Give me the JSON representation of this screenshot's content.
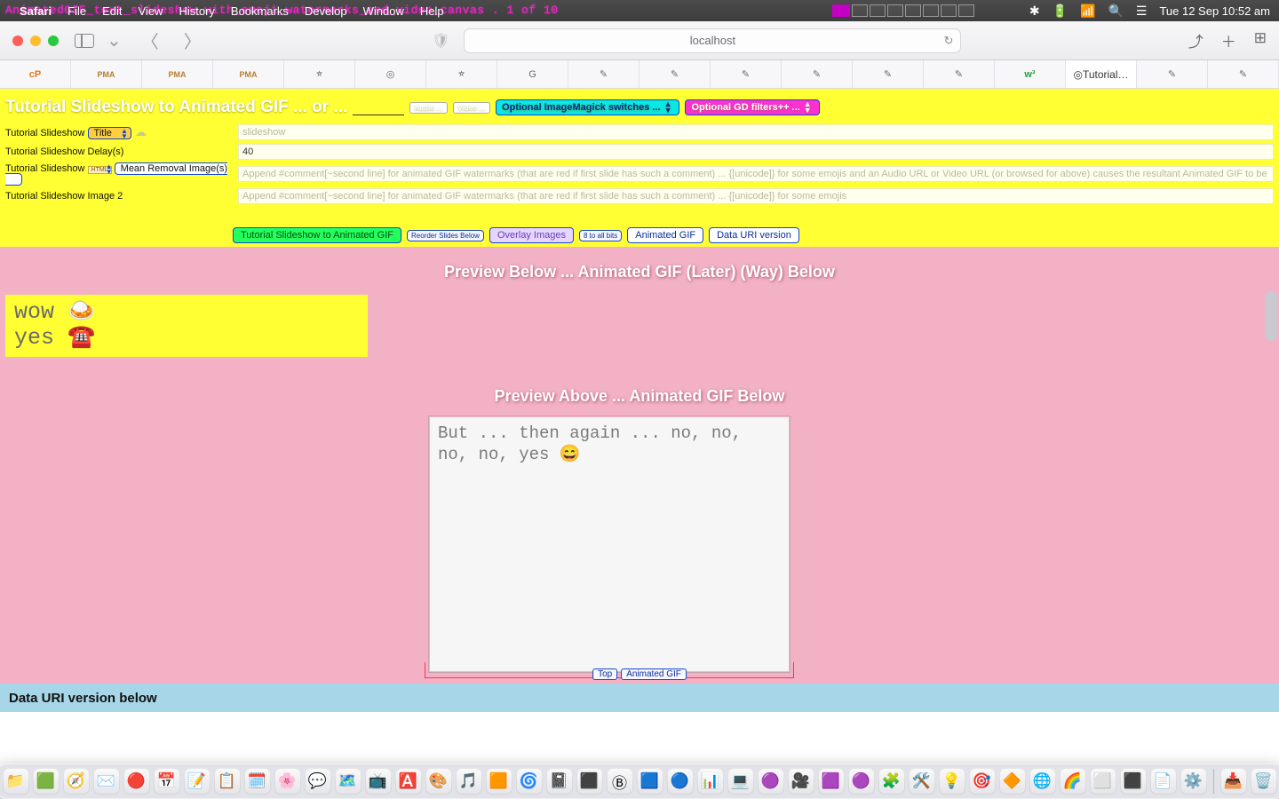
{
  "menubar": {
    "ghost": "AnimatedGIF_text_slideshow_with_emoji_watermarks_and_video_canvas . 1 of 10",
    "app": "Safari",
    "items": [
      "File",
      "Edit",
      "View",
      "History",
      "Bookmarks",
      "Develop",
      "Window",
      "Help"
    ],
    "clock": "Tue 12 Sep  10:52 am"
  },
  "safari": {
    "url": "localhost",
    "tabs": [
      "cP",
      "PMA",
      "PMA",
      "PMA",
      "⭐︎",
      "◎",
      "⭐︎",
      "G",
      "✎",
      "✎",
      "✎",
      "✎",
      "✎",
      "✎",
      "w³",
      "Tutorial…",
      "✎",
      "✎"
    ],
    "activeTab": 15
  },
  "form": {
    "heading": "Tutorial Slideshow to Animated GIF ... or ...",
    "audio_btn": "Audio …",
    "video_btn": "Video …",
    "im_switches": "Optional ImageMagick switches ...",
    "gd_filters": "Optional GD filters++ ...",
    "row1_label": "Tutorial Slideshow",
    "title_sel": "Title",
    "title_val": "slideshow",
    "row2_label": "Tutorial Slideshow Delay(s)",
    "delay_val": "40",
    "row3_label": "Tutorial Slideshow",
    "html_badge": "HTML",
    "mr_sel": "Mean Removal Image(s)",
    "img1_ph": "Append #comment[~second line] for animated GIF watermarks (that are red if first slide has such a comment) ... {[unicode]} for some emojis and an Audio URL or Video URL (or browsed for above) causes the resultant Animated GIF to be its backgrou",
    "row4_label": "Tutorial Slideshow Image 2",
    "img2_ph": "Append #comment[~second line] for animated GIF watermarks (that are red if first slide has such a comment) ... {[unicode]} for some emojis"
  },
  "buttons": {
    "main": "Tutorial Slideshow to Animated GIF",
    "reorder": "Reorder Slides Below",
    "overlay": "Overlay Images",
    "bits": "8 to all bits",
    "anim": "Animated GIF",
    "datauri": "Data URI version"
  },
  "preview": {
    "label1": "Preview Below ... Animated GIF (Later) (Way) Below",
    "card_l1": "wow 🍛",
    "card_l2": " yes ☎️",
    "label2": "Preview Above ... Animated GIF Below",
    "gif_text": "But ... then again ... no, no, no, no, yes 😄",
    "top_link": "Top",
    "anim_link": "Animated GIF"
  },
  "footer": {
    "text": "Data URI version below"
  }
}
